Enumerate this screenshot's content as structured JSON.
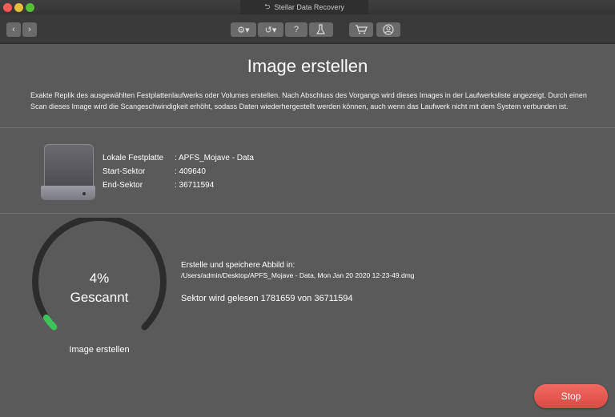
{
  "window": {
    "title": "Stellar Data Recovery"
  },
  "toolbar": {
    "icons": [
      "back-icon",
      "forward-icon",
      "gear-icon",
      "history-icon",
      "help-icon",
      "scan-icon",
      "cart-icon",
      "user-icon"
    ],
    "help_glyph": "?"
  },
  "page": {
    "title": "Image erstellen",
    "description": "Exakte Replik des ausgewählten Festplattenlaufwerks oder Volumes erstellen. Nach Abschluss des Vorgangs wird dieses Images in der Laufwerksliste angezeigt. Durch einen Scan dieses Image wird die Scangeschwindigkeit erhöht, sodass Daten wiederhergestellt werden können, auch wenn das Laufwerk nicht mit dem System verbunden ist."
  },
  "drive_info": {
    "rows": [
      {
        "label": "Lokale Festplatte",
        "value": ": APFS_Mojave - Data"
      },
      {
        "label": "Start-Sektor",
        "value": ": 409640"
      },
      {
        "label": "End-Sektor",
        "value": ": 36711594"
      }
    ]
  },
  "progress": {
    "percent_text": "4%",
    "percent_value": 4,
    "status": "Gescannt",
    "caption": "Image erstellen",
    "save_label": "Erstelle und speichere Abbild in:",
    "save_path": "/Users/admin/Desktop/APFS_Mojave - Data, Mon Jan 20 2020 12-23-49.dmg",
    "sector_text": "Sektor wird gelesen 1781659 von  36711594"
  },
  "actions": {
    "stop_label": "Stop"
  },
  "colors": {
    "background": "#5a5a5a",
    "gauge_track": "#2c2c2c",
    "gauge_fill": "#3ec25a",
    "stop_button": "#e55a53"
  }
}
